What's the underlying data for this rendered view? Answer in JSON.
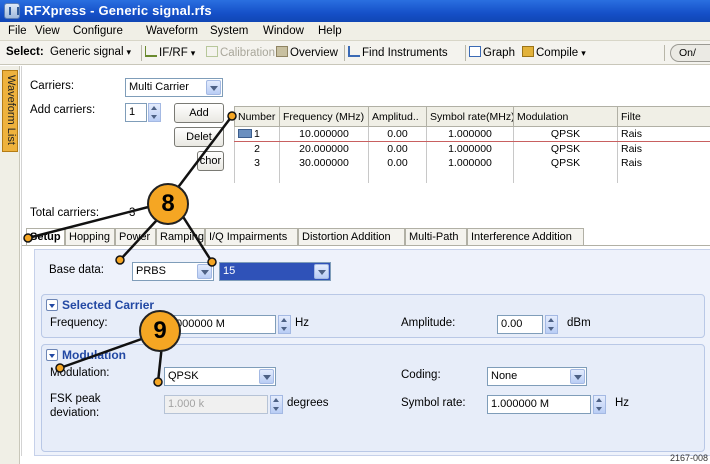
{
  "window": {
    "title": "RFXpress - Generic signal.rfs"
  },
  "menu": [
    "File",
    "View",
    "Configure",
    "Waveform",
    "System",
    "Window",
    "Help"
  ],
  "toolbar": {
    "select_label": "Select:",
    "signal": "Generic signal",
    "ifrf": "IF/RF",
    "calibration": "Calibration",
    "overview": "Overview",
    "find_instruments": "Find Instruments",
    "graph": "Graph",
    "compile": "Compile",
    "onoff": "On/"
  },
  "side_tab": "Waveform List",
  "carriers": {
    "label": "Carriers:",
    "mode": "Multi Carrier",
    "add_label": "Add carriers:",
    "add_count": "1",
    "add_button": "Add",
    "delete_button": "Delet",
    "anchor_button": "chor",
    "total_label": "Total carriers:",
    "total_value": "3"
  },
  "table": {
    "headers": [
      "Number",
      "Frequency (MHz)",
      "Amplitud..",
      "Symbol rate(MHz)",
      "Modulation",
      "Filte"
    ],
    "rows": [
      [
        "1",
        "10.000000",
        "0.00",
        "1.000000",
        "QPSK",
        "Rais"
      ],
      [
        "2",
        "20.000000",
        "0.00",
        "1.000000",
        "QPSK",
        "Rais"
      ],
      [
        "3",
        "30.000000",
        "0.00",
        "1.000000",
        "QPSK",
        "Rais"
      ]
    ]
  },
  "tabs": [
    "Setup",
    "Hopping",
    "Power",
    "Ramping",
    "I/Q Impairments",
    "Distortion Addition",
    "Multi-Path",
    "Interference Addition"
  ],
  "setup": {
    "base_data_label": "Base data:",
    "base_data": "PRBS",
    "prbs_order": "15",
    "selected_carrier_title": "Selected Carrier",
    "frequency_label": "Frequency:",
    "frequency_value": "000000 M",
    "frequency_unit": "Hz",
    "amplitude_label": "Amplitude:",
    "amplitude_value": "0.00",
    "amplitude_unit": "dBm",
    "modulation_title": "Modulation",
    "modulation_label": "Modulation:",
    "modulation_value": "QPSK",
    "coding_label": "Coding:",
    "coding_value": "None",
    "fsk_label_1": "FSK peak",
    "fsk_label_2": "deviation:",
    "fsk_value": "1.000 k",
    "fsk_unit": "degrees",
    "symbol_rate_label": "Symbol rate:",
    "symbol_rate_value": "1.000000 M",
    "symbol_rate_unit": "Hz"
  },
  "callouts": [
    "8",
    "9"
  ],
  "figure_number": "2167-008",
  "colors": {
    "titlebar": "#1550c8",
    "callout": "#f5a623",
    "selection": "#2f52b8",
    "group_title": "#2248a3"
  }
}
